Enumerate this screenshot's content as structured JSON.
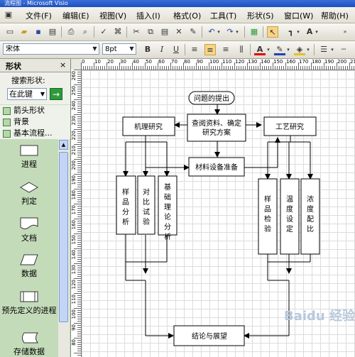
{
  "window": {
    "title": "流程图 - Microsoft Visio"
  },
  "menu": [
    {
      "label": "文件(F)"
    },
    {
      "label": "编辑(E)"
    },
    {
      "label": "视图(V)"
    },
    {
      "label": "插入(I)"
    },
    {
      "label": "格式(O)"
    },
    {
      "label": "工具(T)"
    },
    {
      "label": "形状(S)"
    },
    {
      "label": "窗口(W)"
    },
    {
      "label": "帮助(H)"
    }
  ],
  "format_toolbar": {
    "font": "宋体",
    "size": "8pt",
    "bold": "B",
    "italic": "I",
    "underline": "U",
    "font_color_label": "A"
  },
  "shapes_panel": {
    "title": "形状",
    "close": "×",
    "search_label": "搜索形状:",
    "search_value": "在此键",
    "search_go": "→",
    "stencils": [
      "箭头形状",
      "背景",
      "基本流程..."
    ],
    "items": [
      "进程",
      "判定",
      "文档",
      "数据",
      "预先定义的进程",
      "存储数据"
    ]
  },
  "ruler": {
    "h": [
      "0",
      "10",
      "20",
      "30",
      "40",
      "50",
      "60",
      "70",
      "80",
      "90",
      "100",
      "110",
      "120",
      "130",
      "140",
      "150",
      "160",
      "170",
      "180",
      "190",
      "200",
      "210"
    ],
    "v": [
      "260",
      "250",
      "240",
      "230",
      "220",
      "210",
      "200",
      "190",
      "180",
      "170",
      "160",
      "150",
      "140",
      "130",
      "120",
      "110",
      "100",
      "90",
      "80"
    ]
  },
  "flowchart": {
    "start": "问题的提出",
    "review": "查阅资料、确定研究方案",
    "mechanism": "机理研究",
    "process": "工艺研究",
    "equipment": "材料设备准备",
    "sample_analysis": "样品分析",
    "contrast": "对比试验",
    "theory": "基础理论分析",
    "sample_test": "样品检验",
    "temperature": "温度设定",
    "concentration": "浓度配比",
    "conclusion": "结论与展望"
  },
  "watermark": "Baidu 经验",
  "colors": {
    "menubar": "#ece9d8",
    "panel": "#c9dfc0",
    "grid": "#dcdcdc",
    "accent": "#2e9a3c"
  }
}
